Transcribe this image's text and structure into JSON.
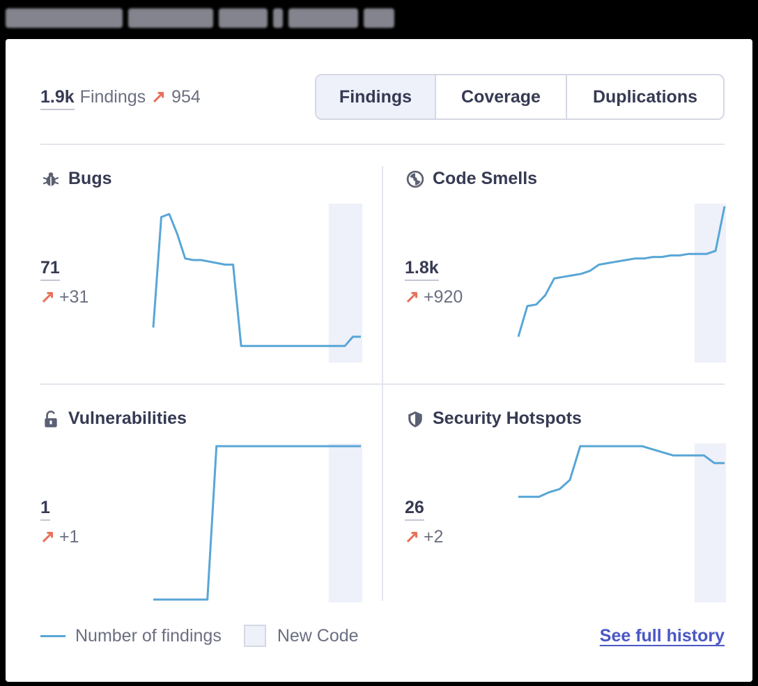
{
  "header": {},
  "summary": {
    "total": "1.9k",
    "label": "Findings",
    "delta": "954"
  },
  "tabs": [
    "Findings",
    "Coverage",
    "Duplications"
  ],
  "active_tab": "Findings",
  "panels": [
    {
      "title": "Bugs",
      "icon": "bug-icon",
      "value": "71",
      "delta": "+31"
    },
    {
      "title": "Code Smells",
      "icon": "code-smell-icon",
      "value": "1.8k",
      "delta": "+920"
    },
    {
      "title": "Vulnerabilities",
      "icon": "lock-icon",
      "value": "1",
      "delta": "+1"
    },
    {
      "title": "Security Hotspots",
      "icon": "shield-icon",
      "value": "26",
      "delta": "+2"
    }
  ],
  "legend": {
    "line_label": "Number of findings",
    "area_label": "New Code"
  },
  "link": {
    "label": "See full history"
  },
  "colors": {
    "line": "#58a6d6",
    "new_code": "#eef0fa",
    "up_arrow": "#e86f58",
    "link": "#4b57c5"
  },
  "chart_data": [
    {
      "type": "line",
      "series": [
        {
          "values": [
            0.21,
            0.93,
            0.95,
            0.82,
            0.66,
            0.65,
            0.65,
            0.64,
            0.63,
            0.62,
            0.62,
            0.09,
            0.09,
            0.09,
            0.09,
            0.09,
            0.09,
            0.09,
            0.09,
            0.09,
            0.09,
            0.09,
            0.09,
            0.09,
            0.09,
            0.15,
            0.15
          ]
        }
      ]
    },
    {
      "type": "line",
      "series": [
        {
          "values": [
            0.15,
            0.35,
            0.36,
            0.42,
            0.53,
            0.54,
            0.55,
            0.56,
            0.58,
            0.62,
            0.63,
            0.64,
            0.65,
            0.66,
            0.66,
            0.67,
            0.67,
            0.68,
            0.68,
            0.69,
            0.69,
            0.69,
            0.71,
            1.0
          ]
        }
      ]
    },
    {
      "type": "line",
      "series": [
        {
          "values": [
            0,
            0,
            0,
            0,
            0,
            0,
            0,
            1,
            1,
            1,
            1,
            1,
            1,
            1,
            1,
            1,
            1,
            1,
            1,
            1,
            1,
            1,
            1,
            1
          ]
        }
      ]
    },
    {
      "type": "line",
      "series": [
        {
          "values": [
            0.67,
            0.67,
            0.67,
            0.7,
            0.72,
            0.78,
            1.0,
            1.0,
            1.0,
            1.0,
            1.0,
            1.0,
            1.0,
            0.98,
            0.96,
            0.94,
            0.94,
            0.94,
            0.94,
            0.89,
            0.89
          ]
        }
      ]
    }
  ]
}
